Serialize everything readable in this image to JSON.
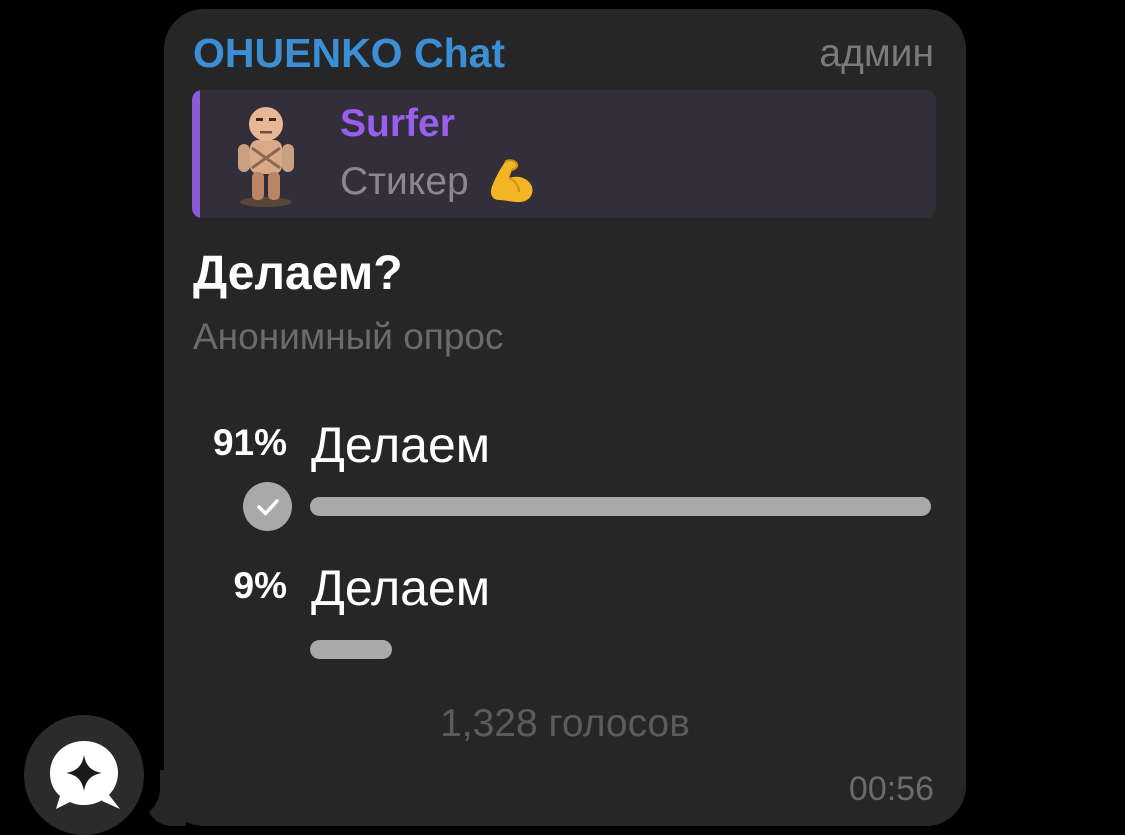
{
  "message": {
    "chat_name": "OHUENKO Chat",
    "author_role": "админ",
    "time": "00:56",
    "reply": {
      "author": "Surfer",
      "preview_text": "Стикер",
      "preview_emoji": "flexed-biceps-emoji",
      "thumbnail": "sticker-thumbnail"
    },
    "poll": {
      "question": "Делаем?",
      "type_label": "Анонимный опрос",
      "options": [
        {
          "percent_label": "91%",
          "label": "Делаем",
          "share": 0.91,
          "selected": true
        },
        {
          "percent_label": "9%",
          "label": "Делаем",
          "share": 0.09,
          "selected": false
        }
      ],
      "total_votes": "1,328 голосов"
    }
  },
  "avatar": {
    "icon": "ai-chat-sparkle-icon"
  },
  "colors": {
    "chat_name": "#3b8fd6",
    "reply_accent": "#8b5ad6",
    "reply_author": "#9b5ff0",
    "bar": "#a9a9a9",
    "bubble": "#262626"
  }
}
